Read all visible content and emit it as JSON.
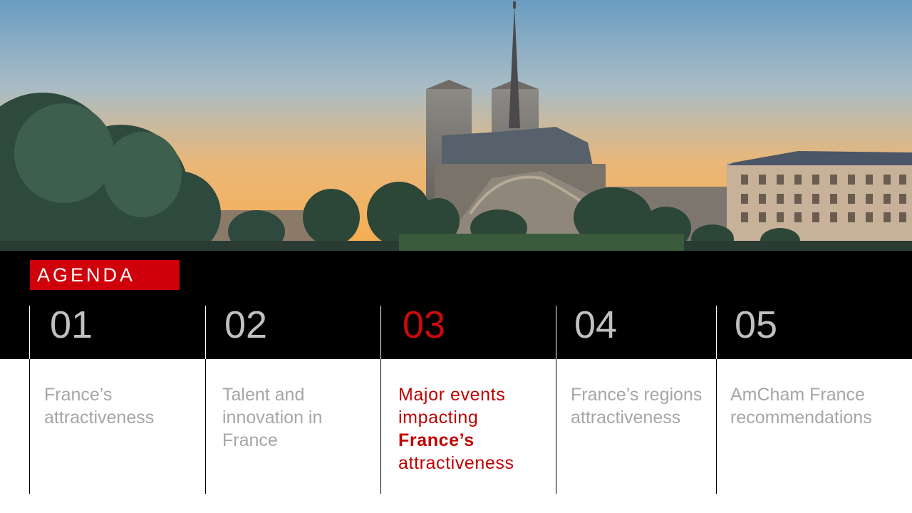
{
  "slide": {
    "agenda_title": "AGENDA",
    "active_index": 2,
    "colors": {
      "accent": "#d0000b",
      "active_text": "#c00000",
      "inactive_number": "#c0c0c0",
      "inactive_text": "#a6a6a6"
    },
    "items": [
      {
        "number": "01",
        "label": "France’s attractiveness"
      },
      {
        "number": "02",
        "label": "Talent and innovation in France"
      },
      {
        "number": "03",
        "label_lines": [
          "Major events",
          "impacting",
          "France’s",
          "attractiveness"
        ]
      },
      {
        "number": "04",
        "label": "France’s regions attractiveness"
      },
      {
        "number": "05",
        "label": "AmCham France recommendations"
      }
    ]
  }
}
